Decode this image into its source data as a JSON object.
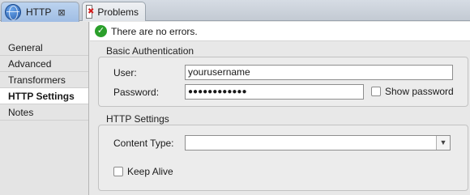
{
  "tabs": [
    {
      "label": "HTTP",
      "icon": "globe-icon",
      "close": "⊠"
    },
    {
      "label": "Problems",
      "icon": "problems-icon"
    }
  ],
  "status": {
    "message": "There are no errors."
  },
  "nav": {
    "items": [
      {
        "label": "General"
      },
      {
        "label": "Advanced"
      },
      {
        "label": "Transformers"
      },
      {
        "label": "HTTP Settings"
      },
      {
        "label": "Notes"
      }
    ],
    "selected": "HTTP Settings"
  },
  "basic_auth": {
    "title": "Basic Authentication",
    "user_label": "User:",
    "user_value": "yourusername",
    "password_label": "Password:",
    "password_value": "●●●●●●●●●●●●",
    "show_password_label": "Show password",
    "show_password_checked": false
  },
  "http_settings": {
    "title": "HTTP Settings",
    "content_type_label": "Content Type:",
    "content_type_value": "",
    "keep_alive_label": "Keep Alive",
    "keep_alive_checked": false
  }
}
